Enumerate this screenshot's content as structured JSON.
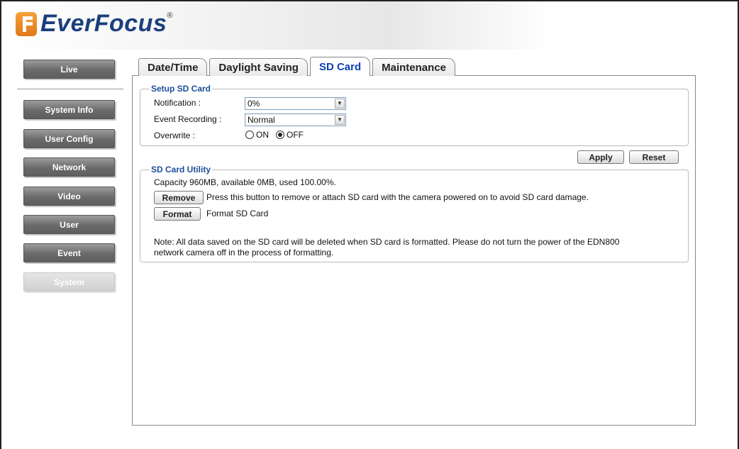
{
  "brand": {
    "name": "EverFocus",
    "reg_mark": "®"
  },
  "sidebar": {
    "items": [
      {
        "label": "Live"
      },
      {
        "label": "System Info"
      },
      {
        "label": "User Config"
      },
      {
        "label": "Network"
      },
      {
        "label": "Video"
      },
      {
        "label": "User"
      },
      {
        "label": "Event"
      },
      {
        "label": "System",
        "active": true
      }
    ]
  },
  "tabs": [
    {
      "label": "Date/Time"
    },
    {
      "label": "Daylight Saving"
    },
    {
      "label": "SD Card",
      "active": true
    },
    {
      "label": "Maintenance"
    }
  ],
  "setup": {
    "title": "Setup SD Card",
    "notification_label": "Notification :",
    "notification_value": "0%",
    "event_recording_label": "Event Recording :",
    "event_recording_value": "Normal",
    "overwrite_label": "Overwrite :",
    "overwrite_on": "ON",
    "overwrite_off": "OFF",
    "overwrite_selected": "OFF"
  },
  "actions": {
    "apply": "Apply",
    "reset": "Reset"
  },
  "utility": {
    "title": "SD Card Utility",
    "capacity": "Capacity 960MB, available 0MB, used 100.00%.",
    "remove_button": "Remove",
    "remove_text": "Press this button to remove or attach SD card with the camera powered on to avoid SD card damage.",
    "format_button": "Format",
    "format_text": "Format SD Card",
    "note_line1": "Note: All data saved on the SD card will be deleted when SD card is formatted. Please do not turn the power of the EDN800",
    "note_line2": "network camera off in the process of formatting."
  },
  "colors": {
    "active_tab": "#0d3fb5",
    "group_title": "#1d4d9a",
    "brand": "#1b3f7d",
    "logo_orange": "#e8861f"
  }
}
